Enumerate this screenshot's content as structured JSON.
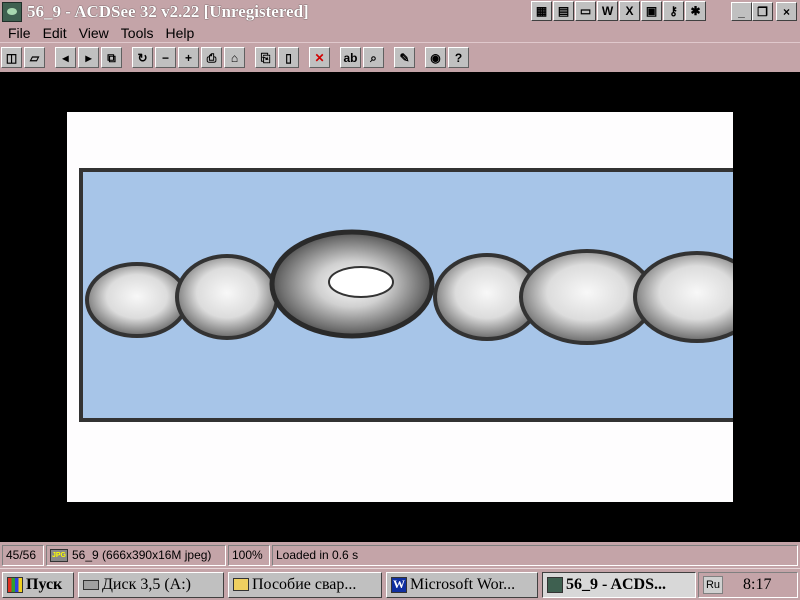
{
  "window": {
    "title": "56_9 - ACDSee 32 v2.22 [Unregistered]",
    "title_bar_color": "#c4a4a8",
    "title_tools": [
      {
        "icon": "multicolor-grid-icon",
        "glyph": "▦"
      },
      {
        "icon": "notepad-icon",
        "glyph": "▤"
      },
      {
        "icon": "folder-icon",
        "glyph": "▭"
      },
      {
        "icon": "word-icon",
        "glyph": "W"
      },
      {
        "icon": "excel-icon",
        "glyph": "X"
      },
      {
        "icon": "display-icon",
        "glyph": "▣"
      },
      {
        "icon": "key-icon",
        "glyph": "⚷"
      },
      {
        "icon": "apps-icon",
        "glyph": "✱"
      }
    ],
    "controls": {
      "minimize": "_",
      "restore": "❐",
      "close": "×"
    }
  },
  "menu": [
    {
      "label": "File"
    },
    {
      "label": "Edit"
    },
    {
      "label": "View"
    },
    {
      "label": "Tools"
    },
    {
      "label": "Help"
    }
  ],
  "toolbar": [
    {
      "icon": "browse-icon",
      "glyph": "◫"
    },
    {
      "icon": "open-folder-icon",
      "glyph": "▱"
    },
    {
      "sep": true
    },
    {
      "icon": "previous-icon",
      "glyph": "◂"
    },
    {
      "icon": "next-icon",
      "glyph": "▸"
    },
    {
      "icon": "fullscreen-icon",
      "glyph": "⧉"
    },
    {
      "sep": true
    },
    {
      "icon": "rotate-icon",
      "glyph": "↻"
    },
    {
      "icon": "zoom-out-icon",
      "glyph": "−"
    },
    {
      "icon": "zoom-in-icon",
      "glyph": "+"
    },
    {
      "icon": "print-icon",
      "glyph": "⎙"
    },
    {
      "icon": "wallpaper-icon",
      "glyph": "⌂"
    },
    {
      "sep": true
    },
    {
      "icon": "copy-icon",
      "glyph": "⎘"
    },
    {
      "icon": "paste-icon",
      "glyph": "▯"
    },
    {
      "sep": true
    },
    {
      "icon": "delete-icon",
      "glyph": "✕",
      "color": "#d00000"
    },
    {
      "sep": true
    },
    {
      "icon": "rename-icon",
      "glyph": "ab"
    },
    {
      "icon": "find-icon",
      "glyph": "⌕"
    },
    {
      "sep": true
    },
    {
      "icon": "tools-icon",
      "glyph": "✎"
    },
    {
      "sep": true
    },
    {
      "icon": "view-icon",
      "glyph": "◉"
    },
    {
      "icon": "help-icon",
      "glyph": "?"
    }
  ],
  "image": {
    "band_color": "#a7c5e8",
    "outline_color": "#333333",
    "bead_color": "#e6e6e6",
    "background": "#fefdfe"
  },
  "status": {
    "count": "45/56",
    "file_icon": "JPG",
    "file": "56_9 (666x390x16M jpeg)",
    "zoom": "100%",
    "load": "Loaded in 0.6 s"
  },
  "taskbar": {
    "start": "Пуск",
    "tasks": [
      {
        "id": "disk",
        "label": "Диск 3,5 (A:)"
      },
      {
        "id": "posobie",
        "label": "Пособие свар..."
      },
      {
        "id": "word",
        "label": "Microsoft Wor..."
      },
      {
        "id": "acdsee",
        "label": "56_9 - ACDS..."
      }
    ],
    "lang": "Ru",
    "clock": "8:17"
  }
}
